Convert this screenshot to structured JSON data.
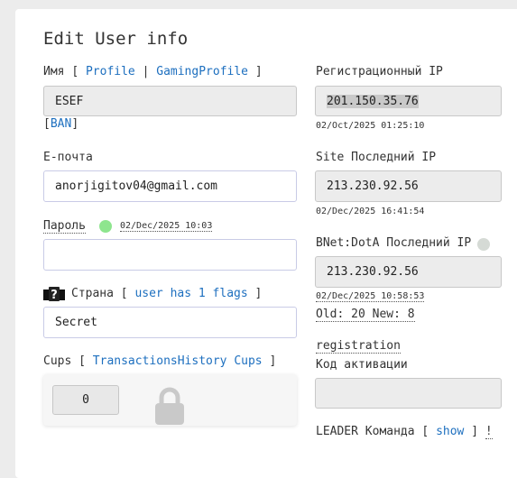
{
  "title": "Edit User info",
  "name": {
    "label": "Имя",
    "bracket_open": "[",
    "sep": "|",
    "bracket_close": "]",
    "profile_link": "Profile",
    "gaming_profile_link": "GamingProfile",
    "value": "ESEF",
    "ban_open": "[",
    "ban_link": "BAN",
    "ban_close": "]"
  },
  "email": {
    "label": "E-почта",
    "value": "anorjigitov04@gmail.com"
  },
  "password": {
    "label": "Пароль",
    "date": "02/Dec/2025 10:03",
    "status_color": "#8ee58e",
    "value": ""
  },
  "country": {
    "icon": "unknown-flag-icon",
    "label": "Страна",
    "bracket_open": "[",
    "flags_link": "user has 1 flags",
    "bracket_close": "]",
    "value": "Secret"
  },
  "cups": {
    "label": "Cups",
    "bracket_open": "[",
    "history_link": "TransactionsHistory Cups",
    "bracket_close": "]",
    "value": "0",
    "lock_icon": "lock-icon"
  },
  "reg_ip": {
    "label": "Регистрационный IP",
    "value": "201.150.35.76",
    "date": "02/Oct/2025 01:25:10"
  },
  "site_ip": {
    "label": "Site Последний IP",
    "value": "213.230.92.56",
    "date": "02/Dec/2025 16:41:54"
  },
  "bnet_ip": {
    "label": "BNet:DotA Последний IP",
    "status_color": "#d5dad5",
    "value": "213.230.92.56",
    "date": "02/Dec/2025 10:58:53",
    "old_new": "Old: 20 New: 8"
  },
  "registration": {
    "link": "registration",
    "activation_label": "Код активации",
    "activation_value": ""
  },
  "leader": {
    "label": "LEADER Команда",
    "bracket_open": "[",
    "show_link": "show",
    "bracket_close": "]",
    "bang": "!"
  },
  "colors": {
    "link": "#1d6fbf",
    "field_grey": "#ececec",
    "page_bg": "#ececec"
  }
}
